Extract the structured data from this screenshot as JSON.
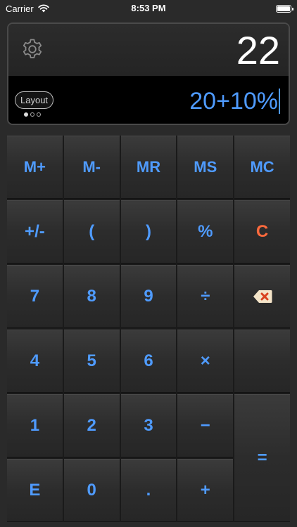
{
  "status_bar": {
    "carrier": "Carrier",
    "time": "8:53 PM"
  },
  "display": {
    "result": "22",
    "expression": "20+10%",
    "layout_button": "Layout",
    "page_dots": 3,
    "active_page": 1
  },
  "keys": {
    "m_plus": "M+",
    "m_minus": "M-",
    "mr": "MR",
    "ms": "MS",
    "mc": "MC",
    "plus_minus": "+/-",
    "open_paren": "(",
    "close_paren": ")",
    "percent": "%",
    "clear": "C",
    "seven": "7",
    "eight": "8",
    "nine": "9",
    "divide": "÷",
    "four": "4",
    "five": "5",
    "six": "6",
    "multiply": "×",
    "one": "1",
    "two": "2",
    "three": "3",
    "minus": "−",
    "equals": "=",
    "e": "E",
    "zero": "0",
    "decimal": ".",
    "plus": "+"
  },
  "icons": {
    "settings": "gear-icon",
    "backspace": "backspace-icon",
    "wifi": "wifi-icon",
    "battery": "battery-icon"
  },
  "colors": {
    "accent_blue": "#4f9bff",
    "clear_red": "#ff6a3d",
    "background": "#2a2a2a"
  }
}
